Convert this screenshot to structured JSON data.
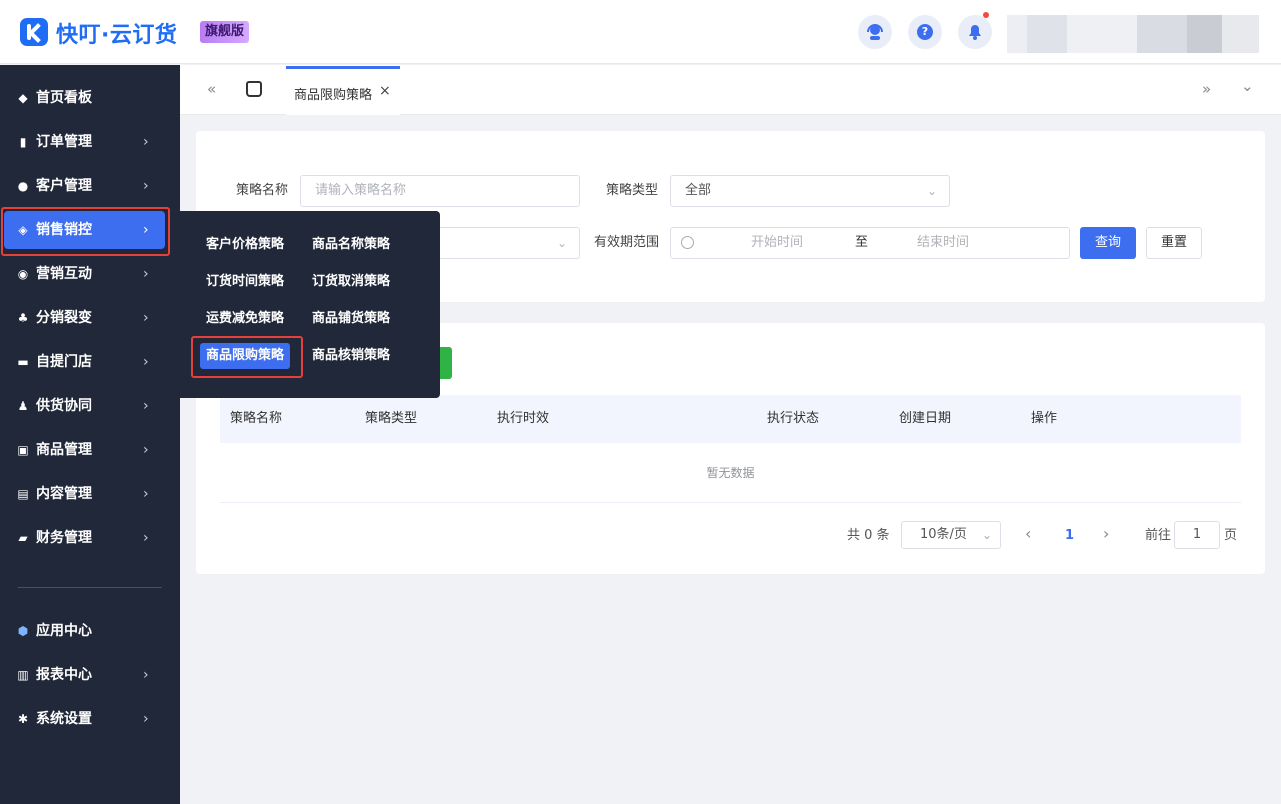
{
  "header": {
    "brand": "快叮·云订货",
    "edition": "旗舰版",
    "help_glyph": "?",
    "icons": [
      "customer-service-icon",
      "help-icon",
      "bell-icon"
    ]
  },
  "sidebar": {
    "items": [
      {
        "label": "首页看板",
        "icon": "dashboard-icon",
        "glyph": "◆"
      },
      {
        "label": "订单管理",
        "icon": "clipboard-icon",
        "glyph": "▮"
      },
      {
        "label": "客户管理",
        "icon": "user-icon",
        "glyph": "●"
      },
      {
        "label": "销售销控",
        "icon": "tag-icon",
        "glyph": "◈"
      },
      {
        "label": "营销互动",
        "icon": "target-icon",
        "glyph": "◉"
      },
      {
        "label": "分销裂变",
        "icon": "hierarchy-icon",
        "glyph": "♣"
      },
      {
        "label": "自提门店",
        "icon": "store-icon",
        "glyph": "▬"
      },
      {
        "label": "供货协同",
        "icon": "supplier-icon",
        "glyph": "♟"
      },
      {
        "label": "商品管理",
        "icon": "bag-icon",
        "glyph": "▣"
      },
      {
        "label": "内容管理",
        "icon": "document-icon",
        "glyph": "▤"
      },
      {
        "label": "财务管理",
        "icon": "wallet-icon",
        "glyph": "▰"
      }
    ],
    "bottom_items": [
      {
        "label": "应用中心",
        "icon": "cube-icon",
        "glyph": "⬢"
      },
      {
        "label": "报表中心",
        "icon": "bar-chart-icon",
        "glyph": "▥"
      },
      {
        "label": "系统设置",
        "icon": "gear-icon",
        "glyph": "✱"
      }
    ],
    "chevron": "›"
  },
  "submenu": {
    "items": [
      "客户价格策略",
      "商品名称策略",
      "订货时间策略",
      "订货取消策略",
      "运费减免策略",
      "商品铺货策略",
      "商品限购策略",
      "商品核销策略"
    ],
    "active": "商品限购策略"
  },
  "tabbar": {
    "collapse_glyph": "«",
    "expand_glyph": "»",
    "dropdown_glyph": "⌄",
    "tab_label": "商品限购策略",
    "tab_close": "×"
  },
  "filters": {
    "name_label": "策略名称",
    "name_placeholder": "请输入策略名称",
    "type_label": "策略类型",
    "type_value": "全部",
    "range_label": "有效期范围",
    "start_placeholder": "开始时间",
    "separator": "至",
    "end_placeholder": "结束时间",
    "query_button": "查询",
    "reset_button": "重置"
  },
  "table": {
    "columns": [
      "策略名称",
      "策略类型",
      "执行时效",
      "执行状态",
      "创建日期",
      "操作"
    ],
    "empty_text": "暂无数据"
  },
  "pagination": {
    "total": "共 0 条",
    "page_size": "10条/页",
    "current_page": "1",
    "goto_label": "前往",
    "goto_value": "1",
    "page_unit": "页"
  },
  "colors": {
    "accent": "#3d6ef0",
    "sidebar_bg": "#21283a",
    "highlight_border": "#e5413a",
    "green_button": "#2fb344"
  }
}
